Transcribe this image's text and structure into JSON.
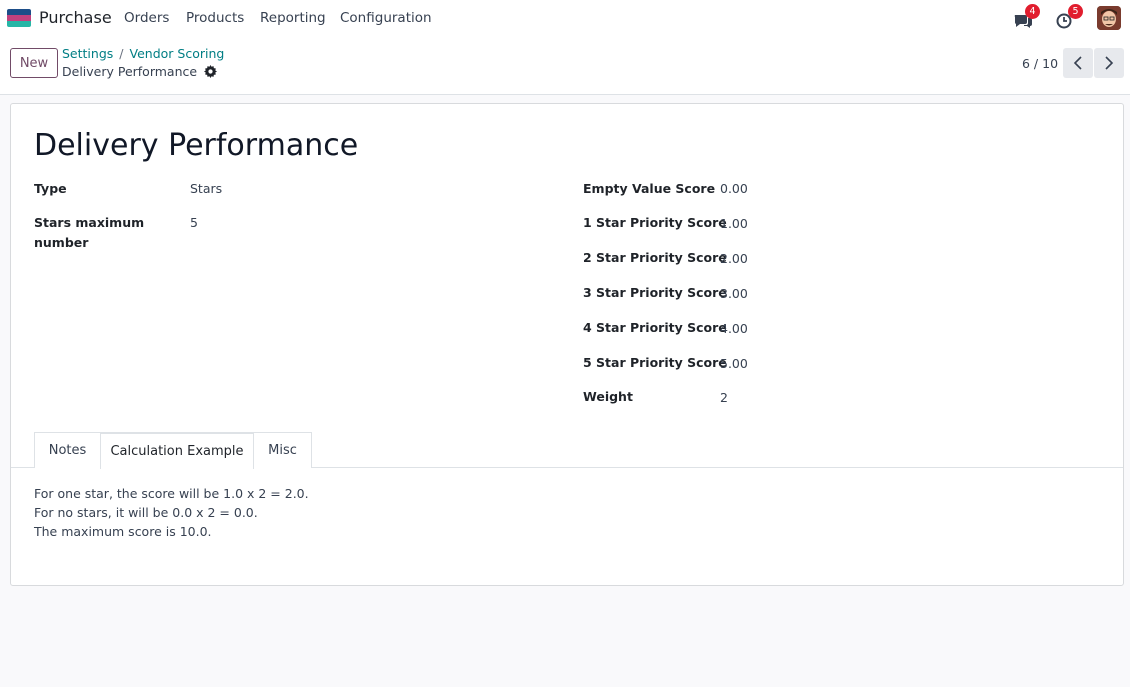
{
  "navbar": {
    "app_name": "Purchase",
    "menu": [
      "Orders",
      "Products",
      "Reporting",
      "Configuration"
    ],
    "messages_count": "4",
    "activities_count": "5",
    "logo_colors": [
      "#1d4e89",
      "#e5467a",
      "#26b6a6"
    ]
  },
  "control_panel": {
    "new_label": "New",
    "breadcrumb": [
      "Settings",
      "/",
      "Vendor Scoring"
    ],
    "record_name": "Delivery Performance",
    "pager": "6 / 10"
  },
  "form": {
    "title": "Delivery Performance",
    "left_fields": [
      {
        "label": "Type",
        "value": "Stars"
      },
      {
        "label": "Stars maximum number",
        "value": "5"
      }
    ],
    "right_fields": [
      {
        "label": "Empty Value Score",
        "value": "0.00"
      },
      {
        "label": "1 Star Priority Score",
        "value": "1.00"
      },
      {
        "label": "2 Star Priority Score",
        "value": "2.00"
      },
      {
        "label": "3 Star Priority Score",
        "value": "3.00"
      },
      {
        "label": "4 Star Priority Score",
        "value": "4.00"
      },
      {
        "label": "5 Star Priority Score",
        "value": "5.00"
      },
      {
        "label": "Weight",
        "value": "2"
      }
    ],
    "tabs": [
      "Notes",
      "Calculation Example",
      "Misc"
    ],
    "active_tab": "Calculation Example",
    "calculation_lines": [
      "For one star, the score will be 1.0 x 2 = 2.0.",
      "For no stars, it will be 0.0 x 2 = 0.0.",
      "The maximum score is 10.0."
    ]
  },
  "colors": {
    "accent": "#714b67",
    "link": "#017e84",
    "badge": "#e11d2e"
  }
}
